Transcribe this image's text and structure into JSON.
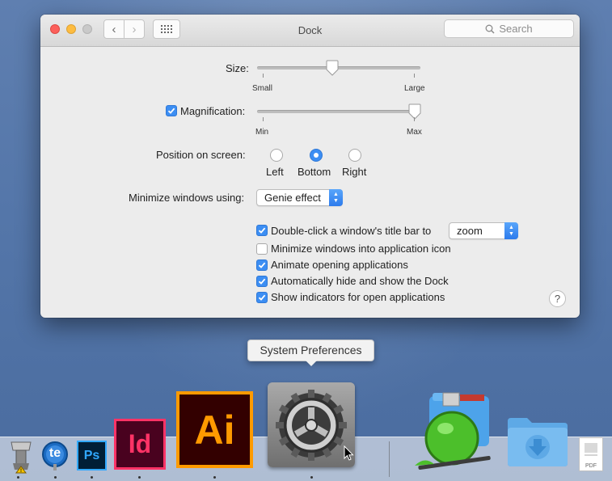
{
  "window": {
    "title": "Dock",
    "search_placeholder": "Search",
    "back_glyph": "‹",
    "forward_glyph": "›"
  },
  "size": {
    "label": "Size:",
    "min_label": "Small",
    "max_label": "Large",
    "value": 0.46
  },
  "magnification": {
    "label": "Magnification:",
    "enabled": true,
    "min_label": "Min",
    "max_label": "Max",
    "value": 1.0
  },
  "position": {
    "label": "Position on screen:",
    "options": [
      "Left",
      "Bottom",
      "Right"
    ],
    "selected": "Bottom"
  },
  "minimize": {
    "label": "Minimize windows using:",
    "value": "Genie effect"
  },
  "options": {
    "double_click": {
      "label": "Double-click a window's title bar to",
      "checked": true,
      "value": "zoom"
    },
    "minimize_into_icon": {
      "label": "Minimize windows into application icon",
      "checked": false
    },
    "animate": {
      "label": "Animate opening applications",
      "checked": true
    },
    "autohide": {
      "label": "Automatically hide and show the Dock",
      "checked": true
    },
    "indicators": {
      "label": "Show indicators for open applications",
      "checked": true
    }
  },
  "help_label": "?",
  "tooltip": "System Preferences",
  "dock": {
    "apps": [
      {
        "name": "Utility",
        "icon": "utility-icon"
      },
      {
        "name": "te",
        "label": "te",
        "icon": "te-icon"
      },
      {
        "name": "Photoshop",
        "label": "Ps",
        "icon": "photoshop-icon"
      },
      {
        "name": "InDesign",
        "label": "Id",
        "icon": "indesign-icon"
      },
      {
        "name": "Illustrator",
        "label": "Ai",
        "icon": "illustrator-icon"
      },
      {
        "name": "System Preferences",
        "icon": "gear-icon"
      }
    ],
    "pdf_label": "PDF"
  },
  "colors": {
    "accent": "#3c8ef3",
    "photoshop": "#31a8ff",
    "indesign": "#ff3366",
    "illustrator": "#ff9a00"
  }
}
